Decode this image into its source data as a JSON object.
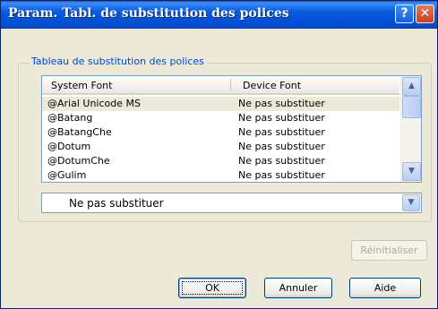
{
  "window": {
    "title": "Param. Tabl. de substitution des polices",
    "help_glyph": "?",
    "close_glyph": "✕"
  },
  "group": {
    "label": "Tableau de substitution des polices"
  },
  "list": {
    "columns": [
      "System Font",
      "Device Font"
    ],
    "rows": [
      {
        "system": "@Arial Unicode MS",
        "device": "Ne pas substituer"
      },
      {
        "system": "@Batang",
        "device": "Ne pas substituer"
      },
      {
        "system": "@BatangChe",
        "device": "Ne pas substituer"
      },
      {
        "system": "@Dotum",
        "device": "Ne pas substituer"
      },
      {
        "system": "@DotumChe",
        "device": "Ne pas substituer"
      },
      {
        "system": "@Gulim",
        "device": "Ne pas substituer"
      }
    ],
    "selected_index": 0
  },
  "combo": {
    "value": "Ne pas substituer"
  },
  "buttons": {
    "reset": "Réinitialiser",
    "ok": "OK",
    "cancel": "Annuler",
    "help": "Aide"
  },
  "icons": {
    "up": "▲",
    "down": "▼",
    "combo_down": "▼"
  },
  "colors": {
    "title_blue": "#0054e3",
    "group_label": "#0046d5",
    "face": "#ece9d8"
  }
}
